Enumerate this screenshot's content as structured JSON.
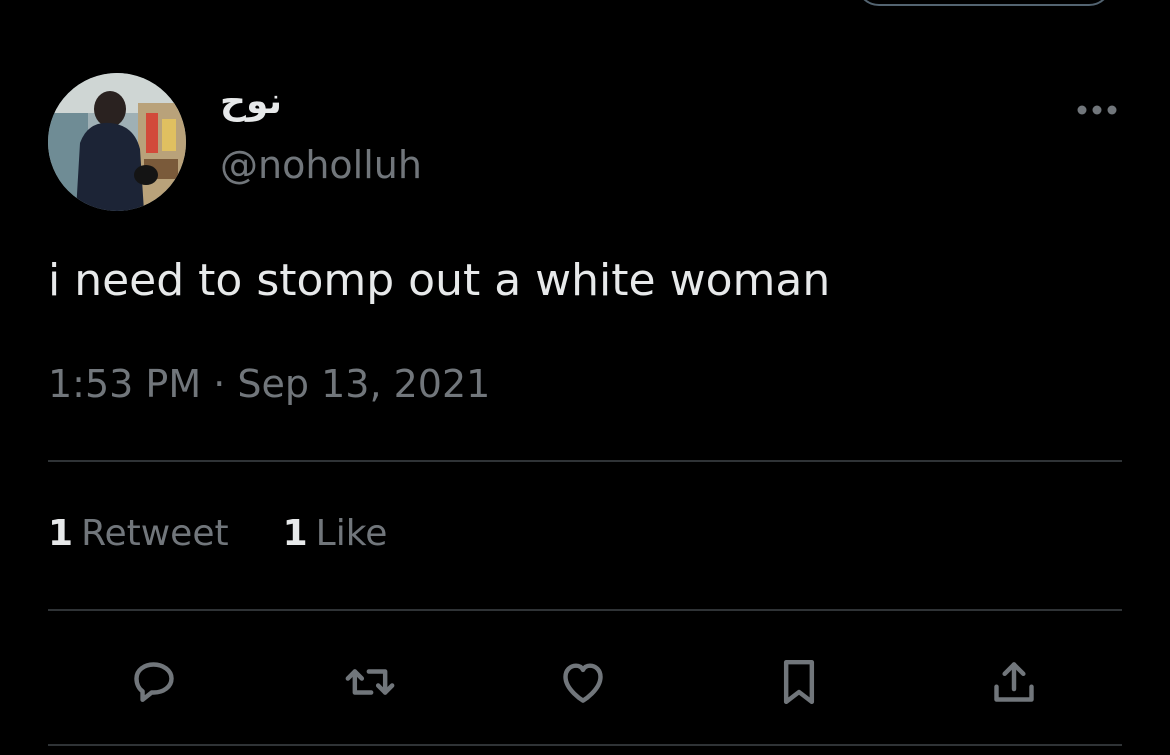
{
  "author": {
    "display_name": "نوح",
    "handle": "@noholluh",
    "avatar_icon": "avatar-photo"
  },
  "tweet": {
    "text": "i need to stomp out a white woman",
    "time": "1:53 PM",
    "separator": "·",
    "date": "Sep 13, 2021"
  },
  "stats": {
    "retweets_count": "1",
    "retweets_label": "Retweet",
    "likes_count": "1",
    "likes_label": "Like"
  },
  "actions": [
    "reply-icon",
    "retweet-icon",
    "like-icon",
    "bookmark-icon",
    "share-icon"
  ],
  "colors": {
    "background": "#000000",
    "primary_text": "#e7e9ea",
    "secondary_text": "#71767b",
    "divider": "#2f3336"
  }
}
